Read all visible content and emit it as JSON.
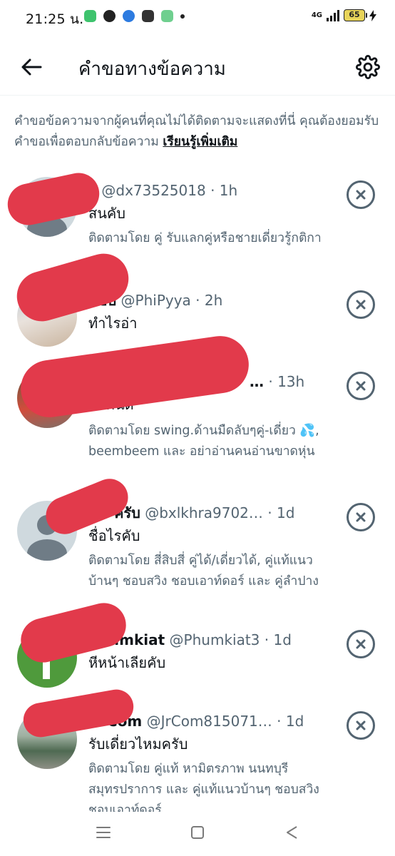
{
  "status_bar": {
    "time": "21:25 น.",
    "network": "4G",
    "battery": "65"
  },
  "header": {
    "title": "คำขอทางข้อความ"
  },
  "intro": {
    "text": "คำขอข้อความจากผู้คนที่คุณไม่ได้ติดตามจะแสดงที่นี่ คุณต้องยอมรับคำขอเพื่อตอบกลับข้อความ",
    "link": "เรียนรู้เพิ่มเติม"
  },
  "requests": [
    {
      "name": "อ",
      "handle": "@dx73525018",
      "time": "· 1h",
      "message": "สนคับ",
      "followed_by": "ติดตามโดย คู่ รับแลกคู่หรือชายเดี่ยวรู้กติกา"
    },
    {
      "name": "แซ่บ",
      "handle": "@PhiPyya",
      "time": "· 2h",
      "message": "ทำไรอ่า",
      "followed_by": ""
    },
    {
      "name": "…",
      "handle": "",
      "time": "· 13h",
      "message": "น่ากินดี",
      "followed_by": "ติดตามโดย swing.ด้านมืดลับๆคู่-เดี่ยว 💦, beembeem และ อย่าอ่านคนอ่านขาดหุ่น"
    },
    {
      "name": "ครับ",
      "handle": "@bxlkhra9702…",
      "time": "· 1d",
      "message": "ชื่อไรคับ",
      "followed_by": "ติดตามโดย สี่สิบสี่ คู่ได้/เดี่ยวได้, คู่แท้แนวบ้านๆ ชอบสวิง ชอบเอาท์ดอร์ และ คู่ลำปาง"
    },
    {
      "name": "Phumkiat",
      "handle": "@Phumkiat3",
      "time": "· 1d",
      "message": "หีหน้าเลียคับ",
      "followed_by": ""
    },
    {
      "name": "Com",
      "handle": "@JrCom815071…",
      "time": "· 1d",
      "message": "รับเดี่ยวไหมครับ",
      "followed_by": "ติดตามโดย คู่แท้ หามิตรภาพ นนทบุรี สมุทรปราการ และ คู่แท้แนวบ้านๆ ชอบสวิง ชอบเอาท์ดอร์"
    }
  ]
}
